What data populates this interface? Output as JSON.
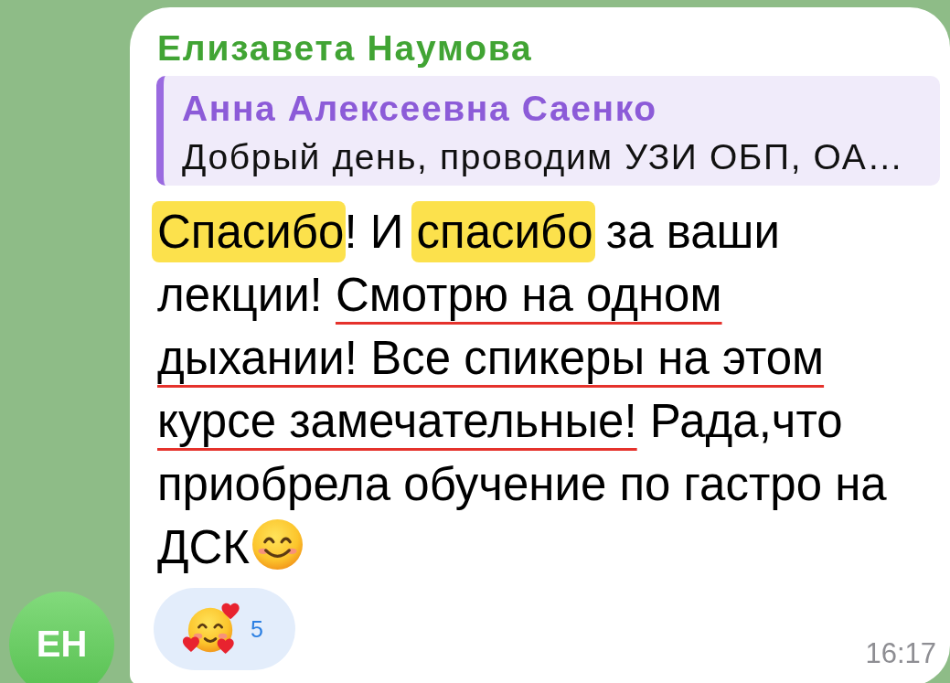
{
  "avatar": {
    "initials": "ЕН"
  },
  "message": {
    "sender": "Елизавета Наумова",
    "reply": {
      "author": "Анна Алексеевна Саенко",
      "text": "Добрый день, проводим УЗИ ОБП, ОА…"
    },
    "segments": [
      {
        "text": "Спасибо",
        "highlighted": true,
        "underlined": false
      },
      {
        "text": "! И ",
        "highlighted": false,
        "underlined": false
      },
      {
        "text": "спасибо",
        "highlighted": true,
        "underlined": false
      },
      {
        "text": " за ваши лекции! ",
        "highlighted": false,
        "underlined": false
      },
      {
        "text": "Смотрю на одном дыхании! Все спикеры на этом курсе замечательные!",
        "highlighted": false,
        "underlined": true
      },
      {
        "text": " Рада,что приобрела обучение по гастро на ДСК",
        "highlighted": false,
        "underlined": false
      }
    ],
    "reactions": [
      {
        "count": "5",
        "selected": false
      }
    ],
    "time": "16:17"
  }
}
